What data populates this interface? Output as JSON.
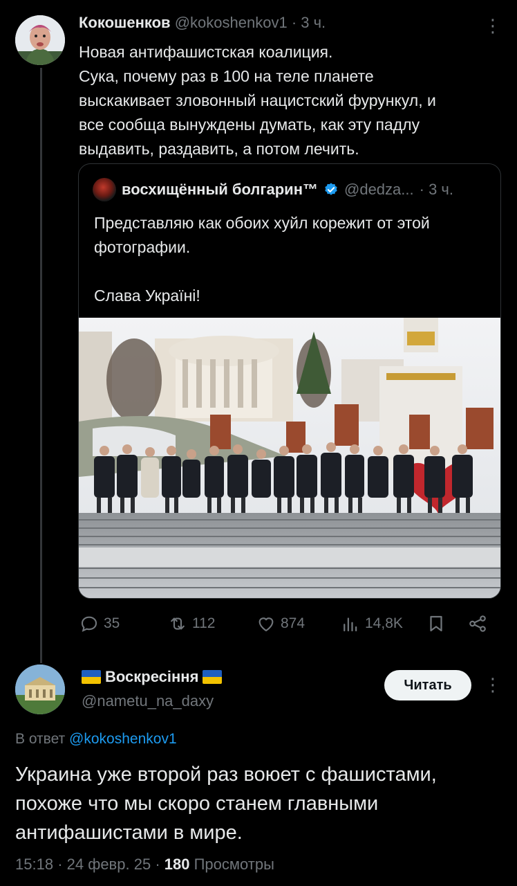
{
  "tweet1": {
    "name": "Кокошенков",
    "handle": "@kokoshenkov1",
    "time": "· 3 ч.",
    "lines": [
      "Новая антифашистская коалиция.",
      "Сука, почему раз в 100 на теле планете",
      "выскакивает зловонный нацистский фурункул, и",
      "все сообща вынуждены думать, как эту падлу",
      "выдавить, раздавить, а потом лечить."
    ],
    "quote": {
      "name": "восхищённый болгарин™",
      "handle": "@dedza...",
      "time": "· 3 ч.",
      "lines": [
        "Представляю как обоих хуйл корежит от этой",
        "фотографии.",
        "",
        "Слава Україні!"
      ]
    },
    "actions": {
      "replies": "35",
      "retweets": "112",
      "likes": "874",
      "views": "14,8K"
    }
  },
  "tweet2": {
    "name": "Воскресіння",
    "handle": "@nametu_na_daxy",
    "follow_label": "Читать",
    "reply_prefix": "В ответ",
    "reply_handle": "@kokoshenkov1",
    "lines": [
      "Украина уже второй раз воюет с фашистами,",
      "похоже что мы скоро станем главными",
      "антифашистами в мире."
    ],
    "time": "15:18",
    "date": "24 февр. 25",
    "views_count": "180",
    "views_label": "Просмотры"
  },
  "colors": {
    "background": "#000000",
    "text": "#e7e9ea",
    "muted": "#71767b",
    "link": "#1d9bf0",
    "like_heart": "#e0245e",
    "flag_blue": "#1f5fbf",
    "flag_yellow": "#f2c200"
  }
}
